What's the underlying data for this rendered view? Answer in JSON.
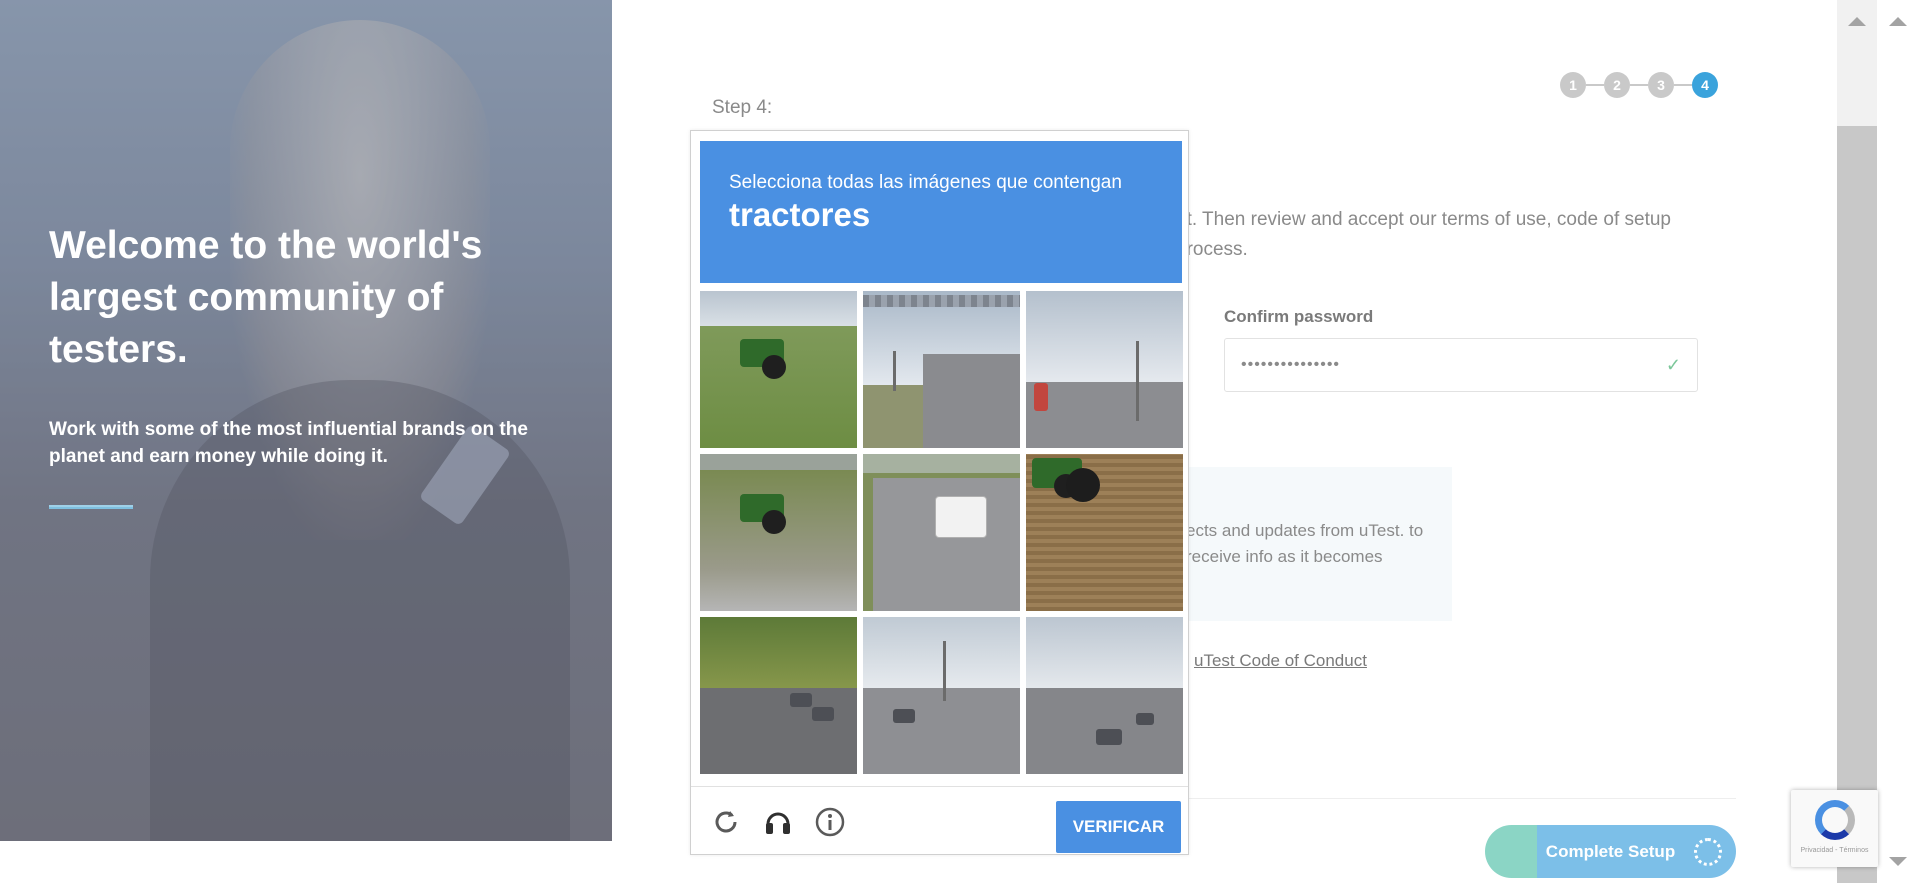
{
  "hero": {
    "title": "Welcome to the world's largest community of testers.",
    "subtitle": "Work with some of the most influential brands on the planet and earn money while doing it."
  },
  "steps": {
    "items": [
      "1",
      "2",
      "3",
      "4"
    ],
    "active": "4",
    "label": "Step 4:"
  },
  "form": {
    "description": "nt. Then review and accept our terms of use, code of setup process.",
    "confirm_password_label": "Confirm password",
    "confirm_password_value": "•••••••••••••••",
    "info_text": "ects and updates from uTest. to receive info as it becomes",
    "code_of_conduct_link": "uTest Code of Conduct",
    "complete_button": "Complete Setup"
  },
  "captcha": {
    "instruction": "Selecciona todas las imágenes que contengan",
    "target": "tractores",
    "verify_button": "VERIFICAR",
    "footer_icons": [
      "reload-icon",
      "audio-icon",
      "info-icon"
    ]
  },
  "recaptcha_badge": {
    "terms": "Privacidad - Términos"
  },
  "colors": {
    "captcha_blue": "#4a90e2",
    "step_active": "#3aa3dc",
    "step_inactive": "#c9c9c9",
    "check_green": "#7cc79a"
  }
}
